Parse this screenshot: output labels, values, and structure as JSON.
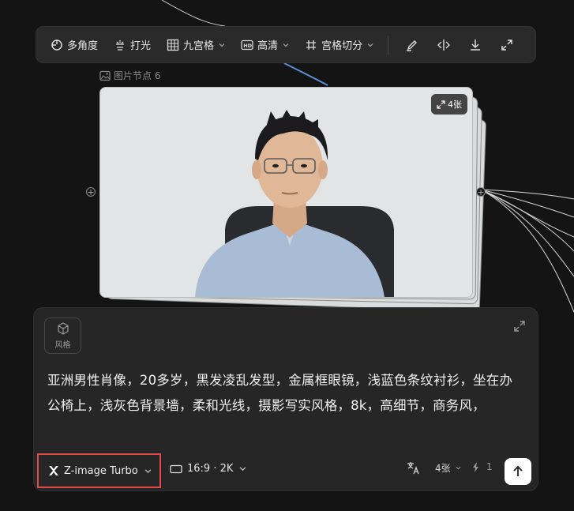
{
  "toolbar": {
    "items": [
      {
        "label": "多角度",
        "icon": "multi-angle-icon"
      },
      {
        "label": "打光",
        "icon": "lighting-icon"
      },
      {
        "label": "九宫格",
        "icon": "grid-icon"
      },
      {
        "label": "高清",
        "icon": "hd-icon"
      },
      {
        "label": "宫格切分",
        "icon": "grid-split-icon"
      }
    ],
    "right_icons": [
      "brush-icon",
      "flip-icon",
      "download-icon",
      "fullscreen-icon"
    ]
  },
  "node": {
    "label": "图片节点 6",
    "count_badge": "4张"
  },
  "prompt_panel": {
    "style_label": "风格",
    "prompt_text": "亚洲男性肖像，20多岁，黑发凌乱发型，金属框眼镜，浅蓝色条纹衬衫，坐在办公椅上，浅灰色背景墙，柔和光线，摄影写实风格，8k，高细节，商务风，",
    "model_label": "Z-image Turbo",
    "ratio_label": "16:9 · 2K",
    "count_label": "4张",
    "credits": "1"
  },
  "colors": {
    "background": "#141414",
    "panel": "#262626",
    "highlight": "#e04a4a"
  }
}
